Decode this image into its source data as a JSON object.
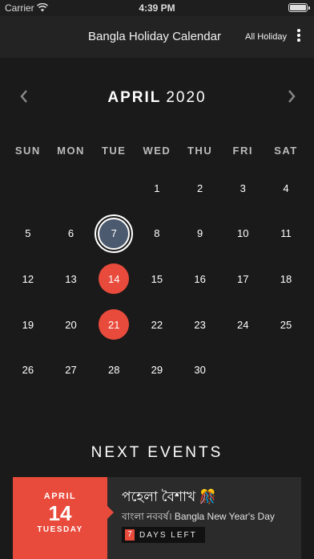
{
  "status_bar": {
    "carrier": "Carrier",
    "time": "4:39 PM"
  },
  "navbar": {
    "title": "Bangla Holiday Calendar",
    "filter_label": "All Holiday"
  },
  "calendar": {
    "month": "APRIL",
    "year": "2020",
    "weekdays": [
      "SUN",
      "MON",
      "TUE",
      "WED",
      "THU",
      "FRI",
      "SAT"
    ],
    "days": [
      {
        "d": ""
      },
      {
        "d": ""
      },
      {
        "d": ""
      },
      {
        "d": "1"
      },
      {
        "d": "2"
      },
      {
        "d": "3"
      },
      {
        "d": "4"
      },
      {
        "d": "5"
      },
      {
        "d": "6"
      },
      {
        "d": "7",
        "state": "today"
      },
      {
        "d": "8"
      },
      {
        "d": "9"
      },
      {
        "d": "10"
      },
      {
        "d": "11"
      },
      {
        "d": "12"
      },
      {
        "d": "13"
      },
      {
        "d": "14",
        "state": "holiday"
      },
      {
        "d": "15"
      },
      {
        "d": "16"
      },
      {
        "d": "17"
      },
      {
        "d": "18"
      },
      {
        "d": "19"
      },
      {
        "d": "20"
      },
      {
        "d": "21",
        "state": "holiday"
      },
      {
        "d": "22"
      },
      {
        "d": "23"
      },
      {
        "d": "24"
      },
      {
        "d": "25"
      },
      {
        "d": "26"
      },
      {
        "d": "27"
      },
      {
        "d": "28"
      },
      {
        "d": "29"
      },
      {
        "d": "30"
      }
    ]
  },
  "next_events": {
    "heading": "NEXT EVENTS",
    "event": {
      "month": "APRIL",
      "day": "14",
      "weekday": "TUESDAY",
      "title": "পহেলা বৈশাখ 🎊",
      "subtitle": "বাংলা নববর্ষ। Bangla New Year's Day",
      "days_left_count": "7",
      "days_left_label": "DAYS LEFT"
    }
  },
  "colors": {
    "accent": "#e84b3c",
    "today_fill": "#4b5a6e",
    "background": "#1a1a1a"
  }
}
